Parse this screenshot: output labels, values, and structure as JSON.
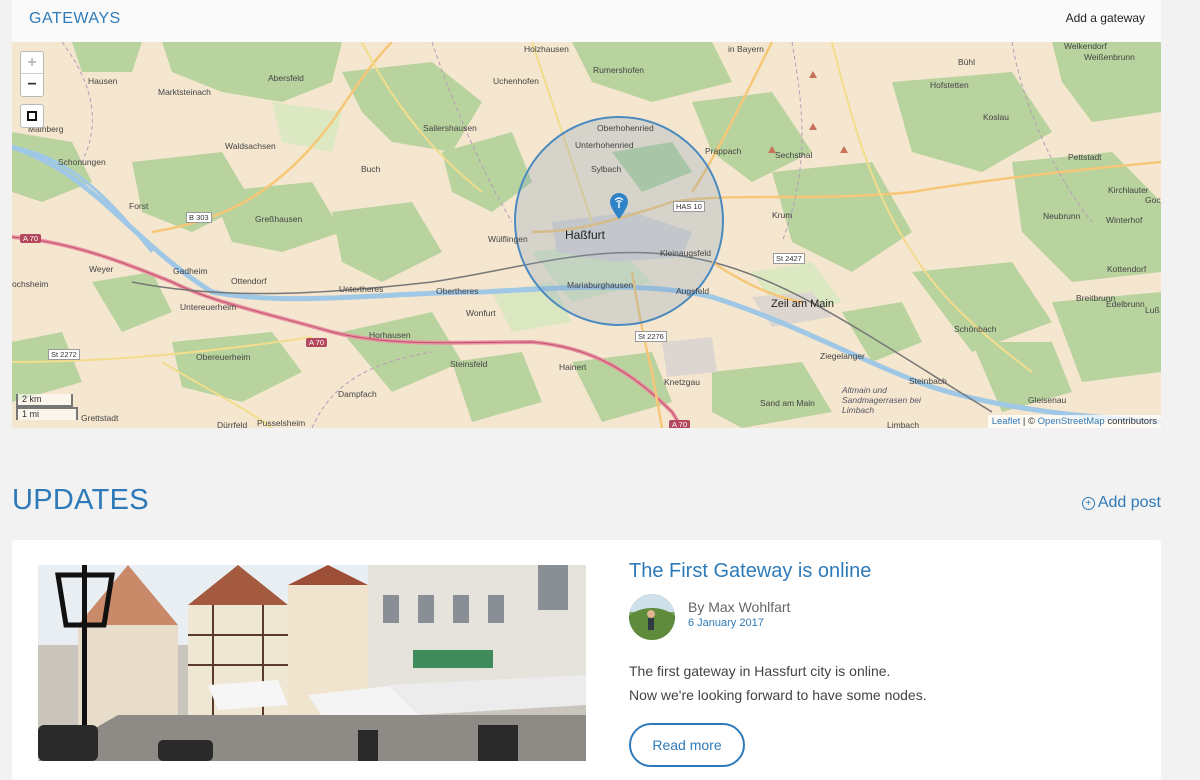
{
  "gateways": {
    "title": "GATEWAYS",
    "add_label": "Add a gateway"
  },
  "map": {
    "zoom_in": "+",
    "zoom_out": "−",
    "scale_km": "2 km",
    "scale_mi": "1 mi",
    "attribution": {
      "leaflet": "Leaflet",
      "separator": " | © ",
      "osm": "OpenStreetMap",
      "suffix": " contributors"
    },
    "labels": {
      "holzhausen": "Holzhausen",
      "in_bayern": "in Bayern",
      "welkendorf": "Welkendorf",
      "weissenbrunn": "Weißenbrunn",
      "hausen": "Hausen",
      "abersfeld": "Abersfeld",
      "uchenhofen": "Uchenhofen",
      "rumershofen": "Rumershofen",
      "buhl": "Bühl",
      "marktsteinach": "Marktsteinach",
      "hofstetten": "Hofstetten",
      "mainberg": "Mainberg",
      "sailershausen": "Sailershausen",
      "oberhohenried": "Oberhohenried",
      "koslau": "Koslau",
      "waldsachsen": "Waldsachsen",
      "unterhohenried": "Unterhohenried",
      "prappach": "Prappach",
      "sechsthal": "Sechsthal",
      "schonungen": "Schonungen",
      "buch": "Buch",
      "sylbach": "Sylbach",
      "pettstadt": "Pettstadt",
      "kirchlauter": "Kirchlauter",
      "forst": "Forst",
      "gresshausen": "Greßhausen",
      "krum": "Krum",
      "neubrunn": "Neubrunn",
      "winterhof": "Winterhof",
      "gock": "Goc",
      "wulflingen": "Wülflingen",
      "hassfurt": "Haßfurt",
      "kleinaugsfeld": "Kleinaugsfeld",
      "weyer": "Weyer",
      "gadheim": "Gadheim",
      "ochsheim": "ochsheim",
      "ottendorf": "Ottendorf",
      "untertheres": "Untertheres",
      "obertheres": "Obertheres",
      "mariaburghausen": "Mariaburghausen",
      "augsfeld": "Augsfeld",
      "zeil": "Zeil am Main",
      "kottendorf": "Kottendorf",
      "untereuerheim": "Untereuerheim",
      "wonfurt": "Wonfurt",
      "breitbrunn": "Breitbrunn",
      "edelbrunn": "Edelbrunn",
      "lussberg": "Luß",
      "horhausen": "Horhausen",
      "schoenbach": "Schönbach",
      "obereuerheim": "Obereuerheim",
      "ziegelanger": "Ziegelanger",
      "steinsfeld": "Steinsfeld",
      "hainert": "Hainert",
      "steinbach": "Steinbach",
      "knetzgau": "Knetzgau",
      "altmain": "Altmain und Sandmagerrasen bei Limbach",
      "dampfach": "Dampfach",
      "sand": "Sand am Main",
      "gleisenau": "Gleisenau",
      "grettstadt": "Grettstadt",
      "limbach": "Limbach",
      "durrfeld": "Dürrfeld",
      "pusselsheim": "Pusselsheim"
    },
    "roads": {
      "a70_west": "A 70",
      "a70_mid": "A 70",
      "a70_south": "A 70",
      "b303": "B 303",
      "has10": "HAS 10",
      "st2427": "St 2427",
      "st2276": "St 2276",
      "st2272": "St 2272"
    }
  },
  "updates": {
    "title": "UPDATES",
    "add_post_label": "Add post",
    "add_post_icon": "plus-circle-icon"
  },
  "post": {
    "title": "The First Gateway is online",
    "author": "By Max Wohlfart",
    "date": "6 January 2017",
    "excerpt_line1": "The first gateway in Hassfurt city is online.",
    "excerpt_line2": "Now we're looking forward to have some nodes.",
    "read_more": "Read more"
  }
}
